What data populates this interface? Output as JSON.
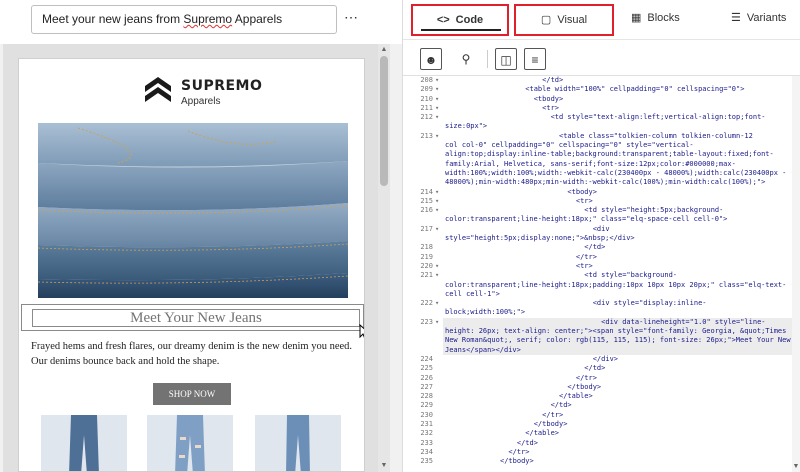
{
  "email_editor": {
    "subject": "Meet your new jeans from ",
    "subject_brand": "Supremo",
    "subject_tail": " Apparels",
    "more_icon": "kebab-menu-icon",
    "logo_name": "SUPREMO",
    "logo_sub": "Apparels",
    "heading": "Meet Your New Jeans",
    "body": "Frayed hems and fresh flares, our dreamy denim is the new denim you need. Our denims bounce back and hold the shape.",
    "cta": "SHOP NOW"
  },
  "tabs": [
    {
      "label": "Code",
      "icon": "code-brackets-icon"
    },
    {
      "label": "Visual",
      "icon": "monitor-icon"
    },
    {
      "label": "Blocks",
      "icon": "blocks-icon"
    },
    {
      "label": "Variants",
      "icon": "stack-icon"
    }
  ],
  "code_lines": [
    {
      "n": "208",
      "f": "▾",
      "t": "                        </td>"
    },
    {
      "n": "209",
      "f": "▾",
      "t": "                    <table width=\"100%\" cellpadding=\"0\" cellspacing=\"0\">"
    },
    {
      "n": "210",
      "f": "▾",
      "t": "                      <tbody>"
    },
    {
      "n": "211",
      "f": "▾",
      "t": "                        <tr>"
    },
    {
      "n": "212",
      "f": "▾",
      "t": "                          <td style=\"text-align:left;vertical-align:top;font-",
      "w": "size:0px\">"
    },
    {
      "n": "213",
      "f": "▾",
      "t": "                            <table class=\"tolkien-column tolkien-column-12",
      "w": "col col-0\" cellpadding=\"0\" cellspacing=\"0\" style=\"vertical-align:top;display:inline-table;background:transparent;table-layout:fixed;font-family:Arial, Helvetica, sans-serif;font-size:12px;color:#000000;max-width:100%;width:100%;width:-webkit-calc(230400px - 48000%);width:calc(230400px - 48000%);min-width:480px;min-width:-webkit-calc(100%);min-width:calc(100%);\">"
    },
    {
      "n": "214",
      "f": "▾",
      "t": "                              <tbody>"
    },
    {
      "n": "215",
      "f": "▾",
      "t": "                                <tr>"
    },
    {
      "n": "216",
      "f": "▾",
      "t": "                                  <td style=\"height:5px;background-",
      "w": "color:transparent;line-height:18px;\" class=\"elq-space-cell cell-0\">"
    },
    {
      "n": "217",
      "f": "▾",
      "t": "                                    <div",
      "w": "style=\"height:5px;display:none;\">&nbsp;</div>"
    },
    {
      "n": "218",
      "f": "",
      "t": "                                  </td>"
    },
    {
      "n": "219",
      "f": "",
      "t": "                                </tr>"
    },
    {
      "n": "220",
      "f": "▾",
      "t": "                                <tr>"
    },
    {
      "n": "221",
      "f": "▾",
      "t": "                                  <td style=\"background-",
      "w": "color:transparent;line-height:18px;padding:10px 10px 10px 20px;\" class=\"elq-text-cell cell-1\">"
    },
    {
      "n": "222",
      "f": "▾",
      "t": "                                    <div style=\"display:inline-",
      "w": "block;width:100%;\">"
    },
    {
      "n": "223",
      "f": "▾",
      "t": "                                      <div data-lineheight=\"1.0\" style=\"line-",
      "w": "height: 26px; text-align: center;\"><span style=\"font-family: Georgia, &quot;Times New Roman&quot;, serif; color: rgb(115, 115, 115); font-size: 26px;\">Meet Your New Jeans</span></div>",
      "hl": true
    },
    {
      "n": "224",
      "f": "",
      "t": "                                    </div>"
    },
    {
      "n": "225",
      "f": "",
      "t": "                                  </td>"
    },
    {
      "n": "226",
      "f": "",
      "t": "                                </tr>"
    },
    {
      "n": "227",
      "f": "",
      "t": "                              </tbody>"
    },
    {
      "n": "228",
      "f": "",
      "t": "                            </table>"
    },
    {
      "n": "229",
      "f": "",
      "t": "                          </td>"
    },
    {
      "n": "230",
      "f": "",
      "t": "                        </tr>"
    },
    {
      "n": "231",
      "f": "",
      "t": "                      </tbody>"
    },
    {
      "n": "232",
      "f": "",
      "t": "                    </table>"
    },
    {
      "n": "233",
      "f": "",
      "t": "                  </td>"
    },
    {
      "n": "234",
      "f": "",
      "t": "                </tr>"
    },
    {
      "n": "235",
      "f": "",
      "t": "              </tbody>"
    }
  ]
}
